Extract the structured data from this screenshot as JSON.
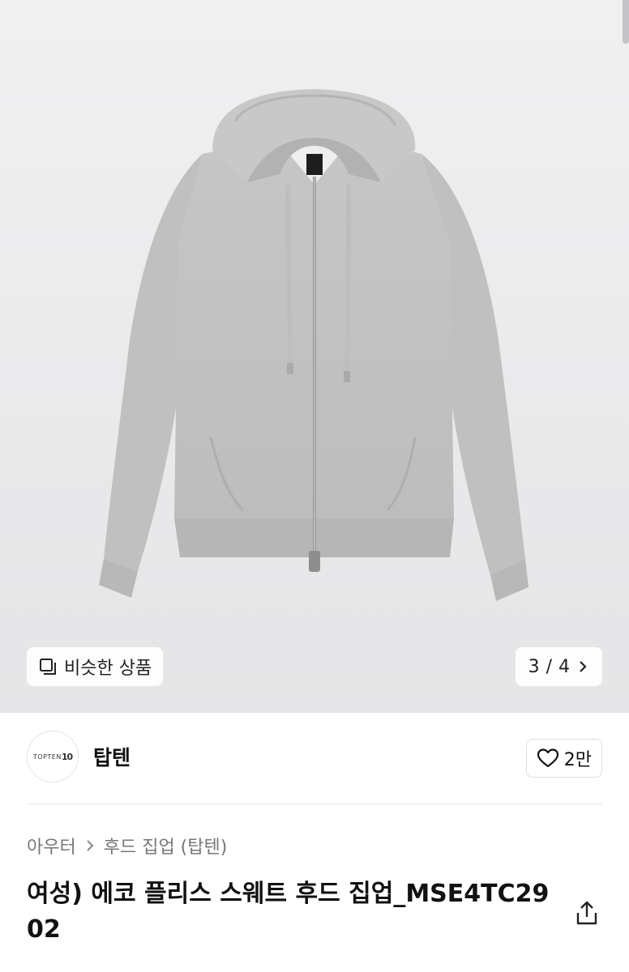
{
  "hero": {
    "similar_label": "비슷한 상품",
    "current_page": "3",
    "page_sep": "/",
    "total_pages": "4"
  },
  "store": {
    "logo_text": "TOPTEN",
    "logo_num": "10",
    "name": "탑텐",
    "likes": "2만"
  },
  "breadcrumb": {
    "category": "아우터",
    "subcategory": "후드 집업 (탑텐)"
  },
  "product": {
    "title": "여성) 에코 플리스 스웨트 후드 집업_MSE4TC2902"
  },
  "icons": {
    "similar": "similar-products-icon",
    "chevron": "chevron-right-icon",
    "heart": "heart-outline-icon",
    "share": "share-icon"
  },
  "colors": {
    "hoodie": "#c4c4c4",
    "hero_bg": "#ececee"
  }
}
